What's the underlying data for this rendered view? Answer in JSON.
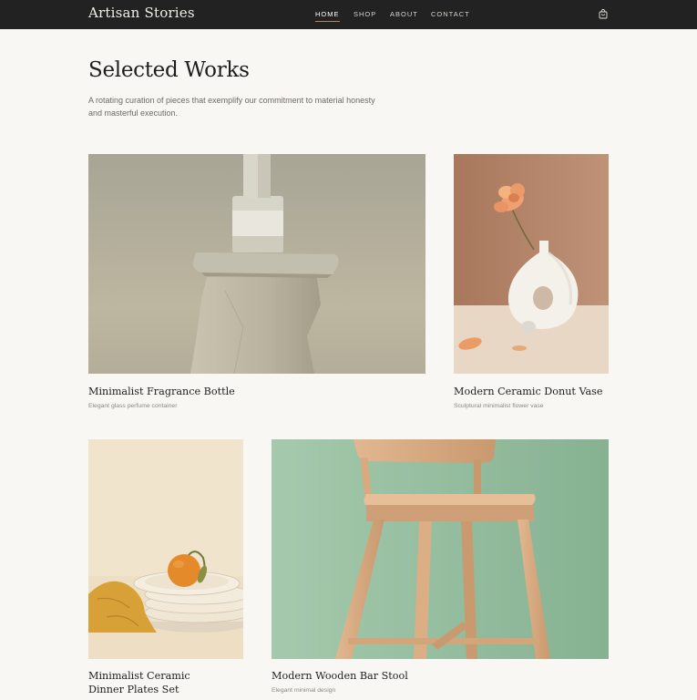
{
  "header": {
    "brand": "Artisan Stories",
    "nav": [
      {
        "label": "HOME",
        "active": true
      },
      {
        "label": "SHOP",
        "active": false
      },
      {
        "label": "ABOUT",
        "active": false
      },
      {
        "label": "CONTACT",
        "active": false
      }
    ],
    "cart_icon": "shopping-bag-icon"
  },
  "main": {
    "title": "Selected Works",
    "intro": "A rotating curation of pieces that exemplify our commitment to material honesty and masterful execution."
  },
  "works": [
    {
      "name": "Minimalist Fragrance Bottle",
      "description": "Elegant glass perfume container"
    },
    {
      "name": "Modern Ceramic Donut Vase",
      "description": "Sculptural minimalist flower vase"
    },
    {
      "name_line1": "Minimalist Ceramic",
      "name_line2": "Dinner Plates Set"
    },
    {
      "name": "Modern Wooden Bar Stool",
      "description": "Elegant minimal design"
    }
  ],
  "colors": {
    "header_bg": "#222222",
    "page_bg": "#f8f7f4",
    "accent_underline": "#b0846a"
  }
}
